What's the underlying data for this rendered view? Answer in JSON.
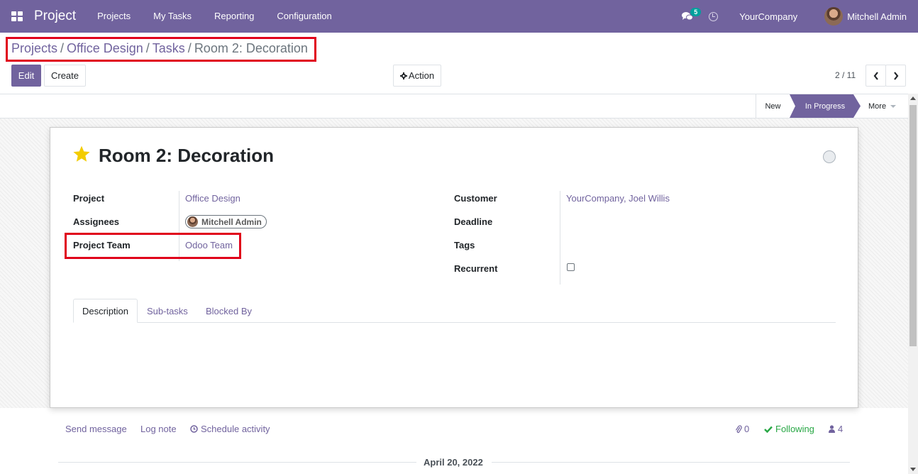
{
  "navbar": {
    "app_name": "Project",
    "menu": [
      "Projects",
      "My Tasks",
      "Reporting",
      "Configuration"
    ],
    "message_count": "5",
    "company": "YourCompany",
    "user": "Mitchell Admin"
  },
  "breadcrumb": {
    "items": [
      "Projects",
      "Office Design",
      "Tasks"
    ],
    "separator": "/",
    "current": "Room 2: Decoration"
  },
  "controls": {
    "edit": "Edit",
    "create": "Create",
    "action": "Action",
    "pager": "2 / 11"
  },
  "stages": {
    "new": "New",
    "in_progress": "In Progress",
    "more": "More"
  },
  "task": {
    "title": "Room 2: Decoration",
    "starred": true,
    "fields_left": [
      {
        "label": "Project",
        "value": "Office Design"
      },
      {
        "label": "Assignees",
        "value": "Mitchell Admin"
      },
      {
        "label": "Project Team",
        "value": "Odoo Team"
      }
    ],
    "fields_right": [
      {
        "label": "Customer",
        "value": "YourCompany, Joel Willis"
      },
      {
        "label": "Deadline",
        "value": ""
      },
      {
        "label": "Tags",
        "value": ""
      },
      {
        "label": "Recurrent",
        "value": ""
      }
    ],
    "recurrent_checked": false
  },
  "tabs": [
    "Description",
    "Sub-tasks",
    "Blocked By"
  ],
  "chatter": {
    "send_message": "Send message",
    "log_note": "Log note",
    "schedule_activity": "Schedule activity",
    "attachments": "0",
    "following": "Following",
    "followers": "4",
    "date": "April 20, 2022"
  },
  "colors": {
    "brand": "#71639e",
    "highlight": "#e0001b",
    "star": "#f3cc00",
    "following": "#28a745"
  }
}
